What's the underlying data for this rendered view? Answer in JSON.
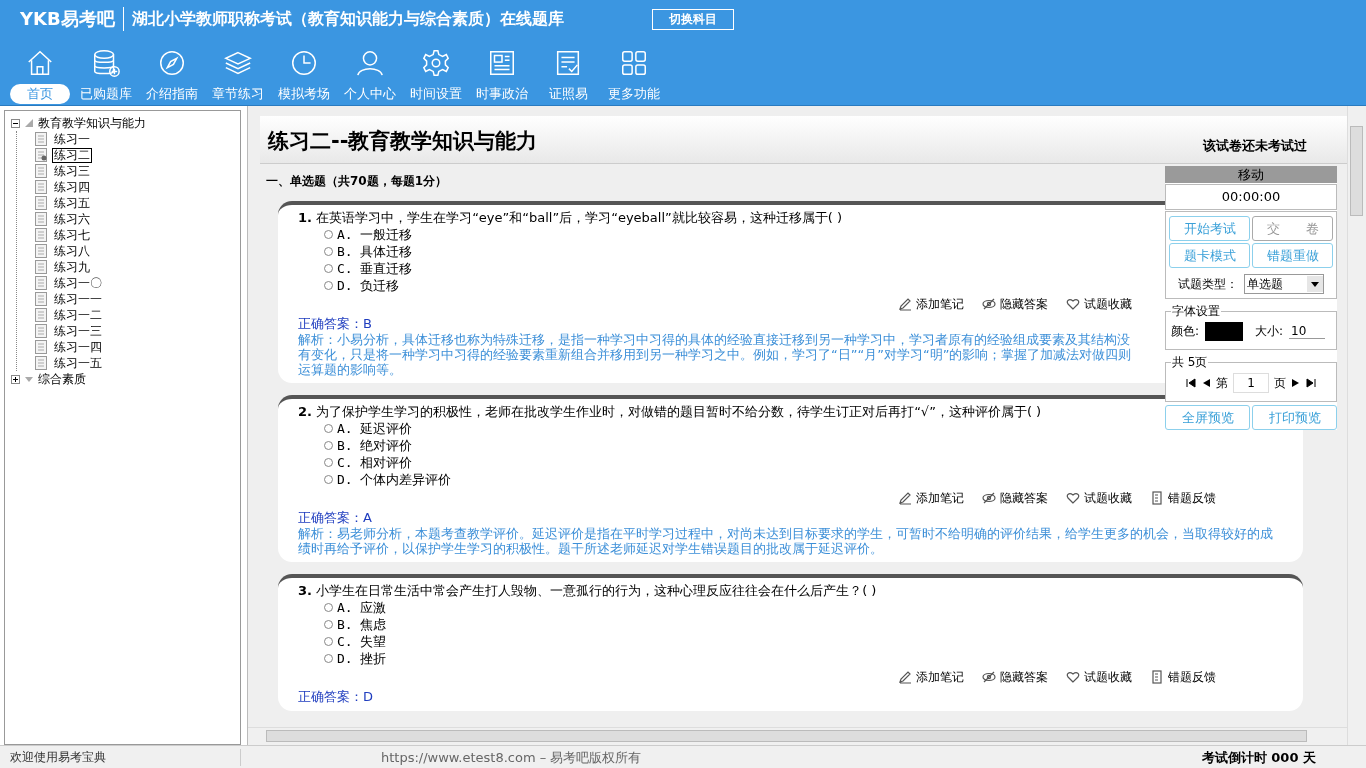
{
  "header": {
    "logo": "YKB易考吧",
    "title": "湖北小学教师职称考试（教育知识能力与综合素质）在线题库",
    "switch_button": "切换科目"
  },
  "nav": [
    {
      "label": "首页",
      "selected": true
    },
    {
      "label": "已购题库",
      "selected": false
    },
    {
      "label": "介绍指南",
      "selected": false
    },
    {
      "label": "章节练习",
      "selected": false
    },
    {
      "label": "模拟考场",
      "selected": false
    },
    {
      "label": "个人中心",
      "selected": false
    },
    {
      "label": "时间设置",
      "selected": false
    },
    {
      "label": "时事政治",
      "selected": false
    },
    {
      "label": "证照易",
      "selected": false
    },
    {
      "label": "更多功能",
      "selected": false
    }
  ],
  "tree": [
    {
      "label": "教育教学知识与能力",
      "expanded": true,
      "children": [
        {
          "label": "练习一",
          "selected": false
        },
        {
          "label": "练习二",
          "selected": true
        },
        {
          "label": "练习三",
          "selected": false
        },
        {
          "label": "练习四",
          "selected": false
        },
        {
          "label": "练习五",
          "selected": false
        },
        {
          "label": "练习六",
          "selected": false
        },
        {
          "label": "练习七",
          "selected": false
        },
        {
          "label": "练习八",
          "selected": false
        },
        {
          "label": "练习九",
          "selected": false
        },
        {
          "label": "练习一〇",
          "selected": false
        },
        {
          "label": "练习一一",
          "selected": false
        },
        {
          "label": "练习一二",
          "selected": false
        },
        {
          "label": "练习一三",
          "selected": false
        },
        {
          "label": "练习一四",
          "selected": false
        },
        {
          "label": "练习一五",
          "selected": false
        }
      ]
    },
    {
      "label": "综合素质",
      "expanded": false
    }
  ],
  "paper": {
    "title": "练习二--教育教学知识与能力",
    "status": "该试卷还未考试过",
    "section": "一、单选题（共70题，每题1分）"
  },
  "questions": [
    {
      "number": "1.",
      "text": "在英语学习中，学生在学习“eye”和“ball”后，学习“eyeball”就比较容易，这种迁移属于( )",
      "options": [
        {
          "label": "A.",
          "text": "一般迁移",
          "selected": false
        },
        {
          "label": "B.",
          "text": "具体迁移",
          "selected": false
        },
        {
          "label": "C.",
          "text": "垂直迁移",
          "selected": false
        },
        {
          "label": "D.",
          "text": "负迁移",
          "selected": false
        }
      ],
      "actions": [
        "添加笔记",
        "隐藏答案",
        "试题收藏"
      ],
      "answer": "正确答案：B",
      "analysis": "解析：小易分析，具体迁移也称为特殊迁移，是指一种学习中习得的具体的经验直接迁移到另一种学习中，学习者原有的经验组成要素及其结构没有变化，只是将一种学习中习得的经验要素重新组合并移用到另一种学习之中。例如，学习了“日”“月”对学习“明”的影响；掌握了加减法对做四则运算题的影响等。"
    },
    {
      "number": "2.",
      "text": "为了保护学生学习的积极性，老师在批改学生作业时，对做错的题目暂时不给分数，待学生订正对后再打“√”，这种评价属于( )",
      "options": [
        {
          "label": "A.",
          "text": "延迟评价",
          "selected": false
        },
        {
          "label": "B.",
          "text": "绝对评价",
          "selected": false
        },
        {
          "label": "C.",
          "text": "相对评价",
          "selected": false
        },
        {
          "label": "D.",
          "text": "个体内差异评价",
          "selected": false
        }
      ],
      "actions": [
        "添加笔记",
        "隐藏答案",
        "试题收藏",
        "错题反馈"
      ],
      "answer": "正确答案：A",
      "analysis": "解析：易老师分析，本题考查教学评价。延迟评价是指在平时学习过程中，对尚未达到目标要求的学生，可暂时不给明确的评价结果，给学生更多的机会，当取得较好的成绩时再给予评价，以保护学生学习的积极性。题干所述老师延迟对学生错误题目的批改属于延迟评价。"
    },
    {
      "number": "3.",
      "text": "小学生在日常生活中常会产生打人毁物、一意孤行的行为，这种心理反应往往会在什么后产生？( )",
      "options": [
        {
          "label": "A.",
          "text": "应激",
          "selected": false
        },
        {
          "label": "B.",
          "text": "焦虑",
          "selected": false
        },
        {
          "label": "C.",
          "text": "失望",
          "selected": false
        },
        {
          "label": "D.",
          "text": "挫折",
          "selected": false
        }
      ],
      "actions": [
        "添加笔记",
        "隐藏答案",
        "试题收藏",
        "错题反馈"
      ],
      "answer": "正确答案：D"
    }
  ],
  "panel": {
    "move_label": "移动",
    "timer": "00:00:00",
    "buttons": [
      {
        "label": "开始考试",
        "disabled": false
      },
      {
        "label": "交　　卷",
        "disabled": true
      },
      {
        "label": "题卡模式",
        "disabled": false
      },
      {
        "label": "错题重做",
        "disabled": false
      }
    ],
    "type_label": "试题类型：",
    "type_value": "单选题",
    "font_legend": "字体设置",
    "color_label": "颜色:",
    "size_label": "大小:",
    "size_value": "10",
    "pages_legend": "共 5页",
    "page_prefix": "第",
    "page_value": "1",
    "page_suffix": "页",
    "bottom_buttons": [
      "全屏预览",
      "打印预览"
    ]
  },
  "status_bar": {
    "welcome": "欢迎使用易考宝典",
    "copyright": "https://www.etest8.com – 易考吧版权所有",
    "countdown": "考试倒计时 000 天"
  }
}
